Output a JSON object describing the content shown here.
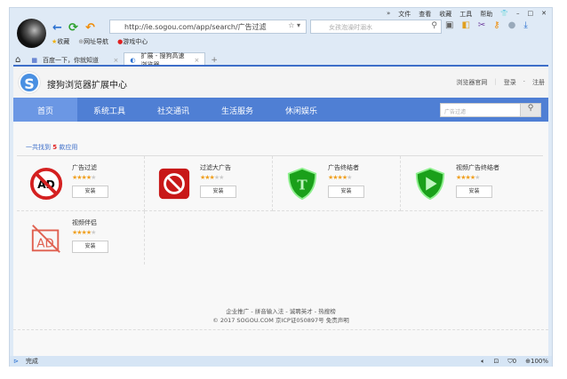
{
  "menu": [
    "»",
    "文件",
    "查看",
    "收藏",
    "工具",
    "帮助",
    "👕",
    "–",
    "□",
    "✕"
  ],
  "toolbar": {
    "address": "http://ie.sogou.com/app/search/广告过滤",
    "address_host": "ie.sogou.com",
    "search_placeholder": "女孩泡澡时溺水"
  },
  "favorites": [
    "收藏",
    "网址导航",
    "游戏中心"
  ],
  "tabs": [
    {
      "label": "百度一下，你就知道"
    },
    {
      "label": "扩展 - 搜狗高速浏览器"
    }
  ],
  "header": {
    "title": "搜狗浏览器扩展中心",
    "link_official": "浏览器官网",
    "login": "登录",
    "register": "注册",
    "sep": "·"
  },
  "nav": {
    "items": [
      "首页",
      "系统工具",
      "社交通讯",
      "生活服务",
      "休闲娱乐"
    ],
    "search_placeholder": "广告过滤"
  },
  "results": {
    "prefix": "一共找到",
    "count": "5",
    "suffix": "款应用"
  },
  "apps": [
    {
      "name": "广告过滤",
      "rating": 4,
      "button": "安装"
    },
    {
      "name": "过滤大广告",
      "rating": 3,
      "button": "安装"
    },
    {
      "name": "广告终结者",
      "rating": 4,
      "button": "安装"
    },
    {
      "name": "视频广告终结者",
      "rating": 4,
      "button": "安装"
    },
    {
      "name": "视频伴侣",
      "rating": 4,
      "button": "安装"
    }
  ],
  "footer": {
    "links": "企业推广 - 拼音输入法 - 诚聘英才 - 热搜榜",
    "copyright": "© 2017 SOGOU.COM 京ICP证050897号 免责声明"
  },
  "status": {
    "text": "完成",
    "shield_count": "0",
    "zoom": "100%"
  }
}
